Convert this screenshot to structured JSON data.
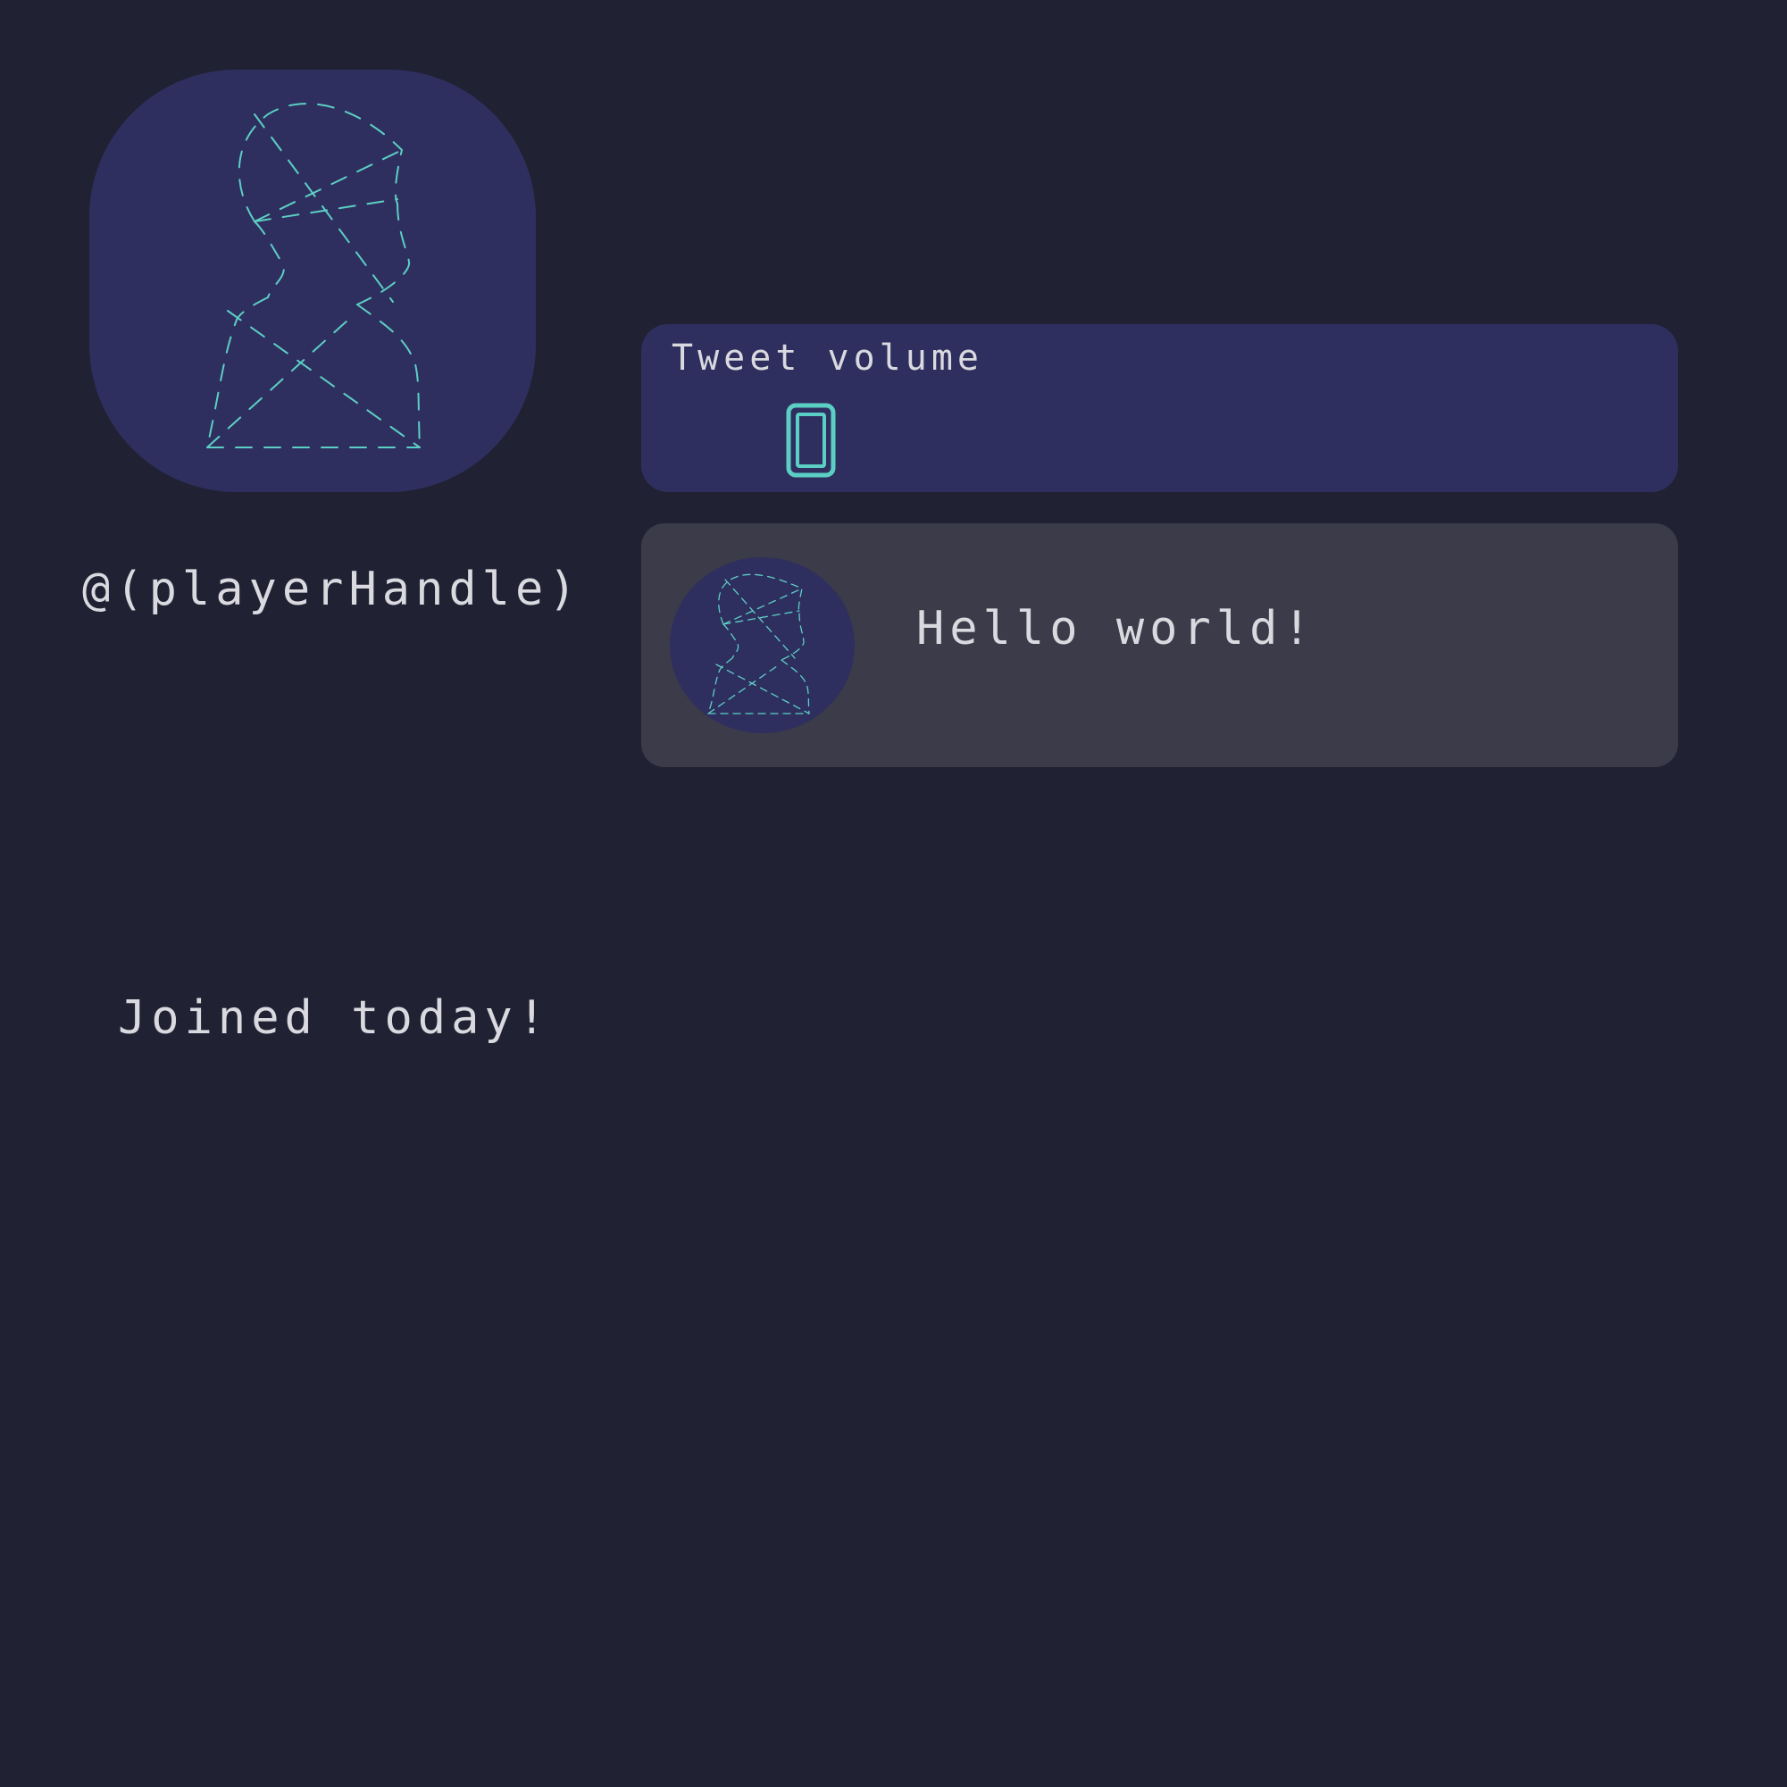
{
  "profile": {
    "avatar_icon": "person-outline-icon",
    "handle": "@(playerHandle)",
    "joined_text": "Joined today!"
  },
  "tweet_volume": {
    "title": "Tweet volume",
    "bar_icon": "volume-bar-icon"
  },
  "tweet": {
    "avatar_icon": "person-outline-icon",
    "text": "Hello world!"
  },
  "colors": {
    "background": "#202133",
    "panel": "#2f2f5f",
    "tweet_card": "#3c3b49",
    "accent": "#5ccfc4",
    "text": "#d9d9df"
  }
}
